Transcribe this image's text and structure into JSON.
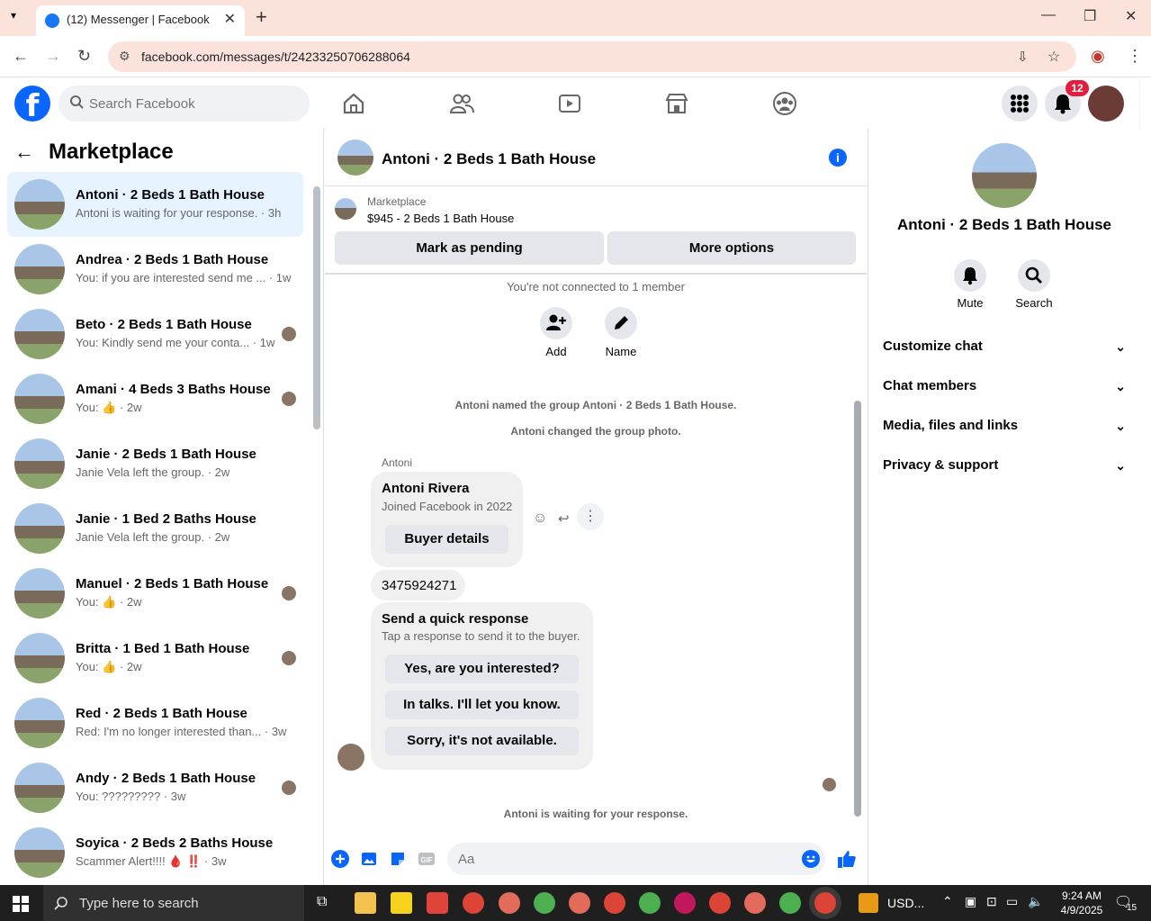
{
  "browser": {
    "tab_title": "(12) Messenger | Facebook",
    "url": "facebook.com/messages/t/24233250706288064"
  },
  "header": {
    "search_placeholder": "Search Facebook",
    "notification_count": "12"
  },
  "sidebar": {
    "title": "Marketplace",
    "conversations": [
      {
        "name": "Antoni · 2 Beds 1 Bath House",
        "preview": "Antoni is waiting for your response. · 3h",
        "active": true
      },
      {
        "name": "Andrea · 2 Beds 1 Bath House",
        "preview": "You: if you are interested send me ... · 1w"
      },
      {
        "name": "Beto · 2 Beds 1 Bath House",
        "preview": "You: Kindly send me your conta... · 1w"
      },
      {
        "name": "Amani · 4 Beds 3 Baths House",
        "preview": "You: 👍 · 2w"
      },
      {
        "name": "Janie · 2 Beds 1 Bath House",
        "preview": "Janie Vela left the group. · 2w"
      },
      {
        "name": "Janie · 1 Bed 2 Baths House",
        "preview": "Janie Vela left the group. · 2w"
      },
      {
        "name": "Manuel · 2 Beds 1 Bath House",
        "preview": "You: 👍 · 2w"
      },
      {
        "name": "Britta · 1 Bed 1 Bath House",
        "preview": "You: 👍 · 2w"
      },
      {
        "name": "Red · 2 Beds 1 Bath House",
        "preview": "Red: I'm no longer interested than... · 3w"
      },
      {
        "name": "Andy · 2 Beds 1 Bath House",
        "preview": "You: ????????? · 3w"
      },
      {
        "name": "Soyica · 2 Beds 2 Baths House",
        "preview": "Scammer Alert!!!! 🩸 ‼️ · 3w"
      }
    ]
  },
  "chat": {
    "title": "Antoni · 2 Beds 1 Bath House",
    "listing_label": "Marketplace",
    "listing_value": "$945 - 2 Beds 1 Bath House",
    "mark_pending": "Mark as pending",
    "more_options": "More options",
    "not_connected": "You're not connected to 1 member",
    "add_label": "Add",
    "name_label": "Name",
    "sys1": "Antoni named the group Antoni · 2 Beds 1 Bath House.",
    "sys2": "Antoni changed the group photo.",
    "sender": "Antoni",
    "card_name": "Antoni Rivera",
    "card_joined": "Joined Facebook in 2022",
    "buyer_details": "Buyer details",
    "phone": "3475924271",
    "quick_title": "Send a quick response",
    "quick_sub": "Tap a response to send it to the buyer.",
    "quick_options": [
      "Yes, are you interested?",
      "In talks. I'll let you know.",
      "Sorry, it's not available."
    ],
    "waiting": "Antoni is waiting for your response.",
    "composer_placeholder": "Aa"
  },
  "details": {
    "name": "Antoni · 2 Beds 1 Bath House",
    "mute": "Mute",
    "search": "Search",
    "sections": [
      "Customize chat",
      "Chat members",
      "Media, files and links",
      "Privacy & support"
    ]
  },
  "taskbar": {
    "search_placeholder": "Type here to search",
    "ticker": "USD...",
    "time": "9:24 AM",
    "date": "4/9/2025",
    "notif": "15"
  },
  "colors": {
    "accent": "#0866ff",
    "active_row": "#e7f3ff",
    "badge": "#e41e3f"
  }
}
